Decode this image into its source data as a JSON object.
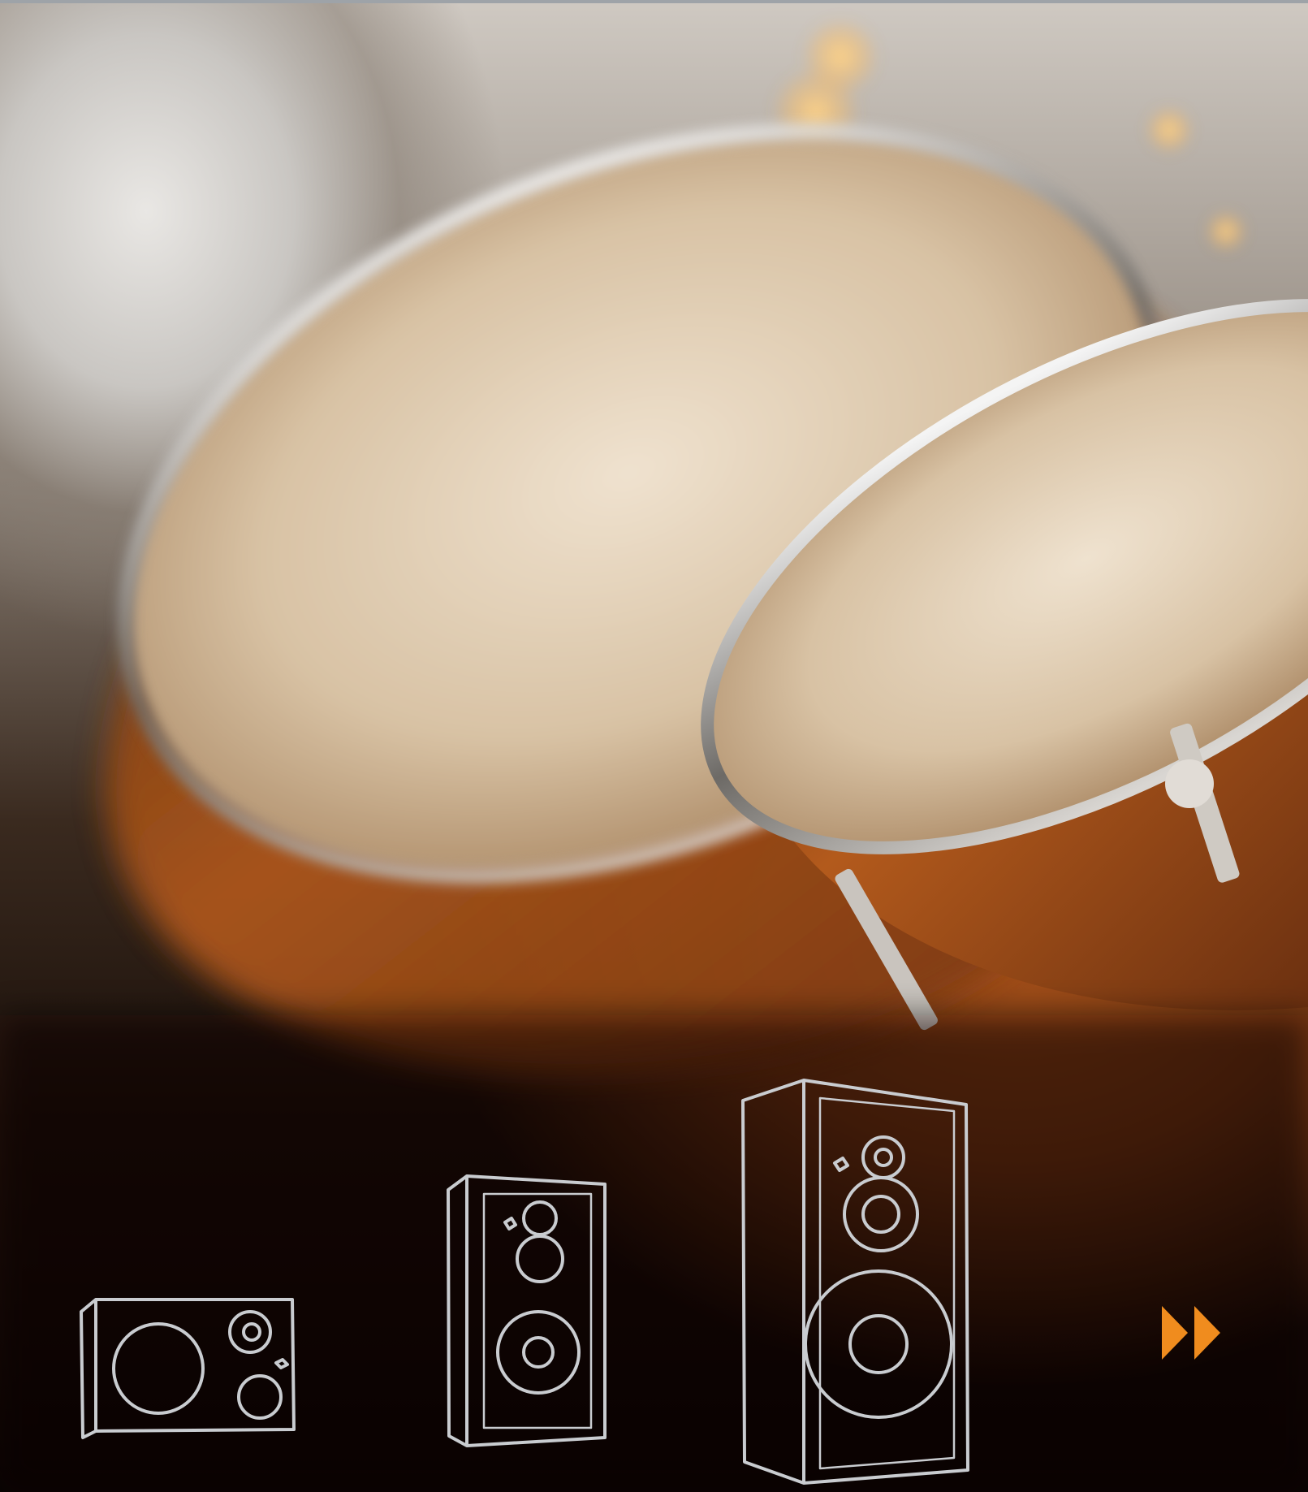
{
  "colors": {
    "accent": "#f08c1e",
    "speaker_outline": "#c9ccd0",
    "top_rule": "#9ea3a8"
  },
  "icons": {
    "small_speaker": "speaker-small-icon",
    "medium_speaker": "speaker-medium-icon",
    "large_speaker": "speaker-large-icon",
    "next": "fast-forward-icon"
  }
}
